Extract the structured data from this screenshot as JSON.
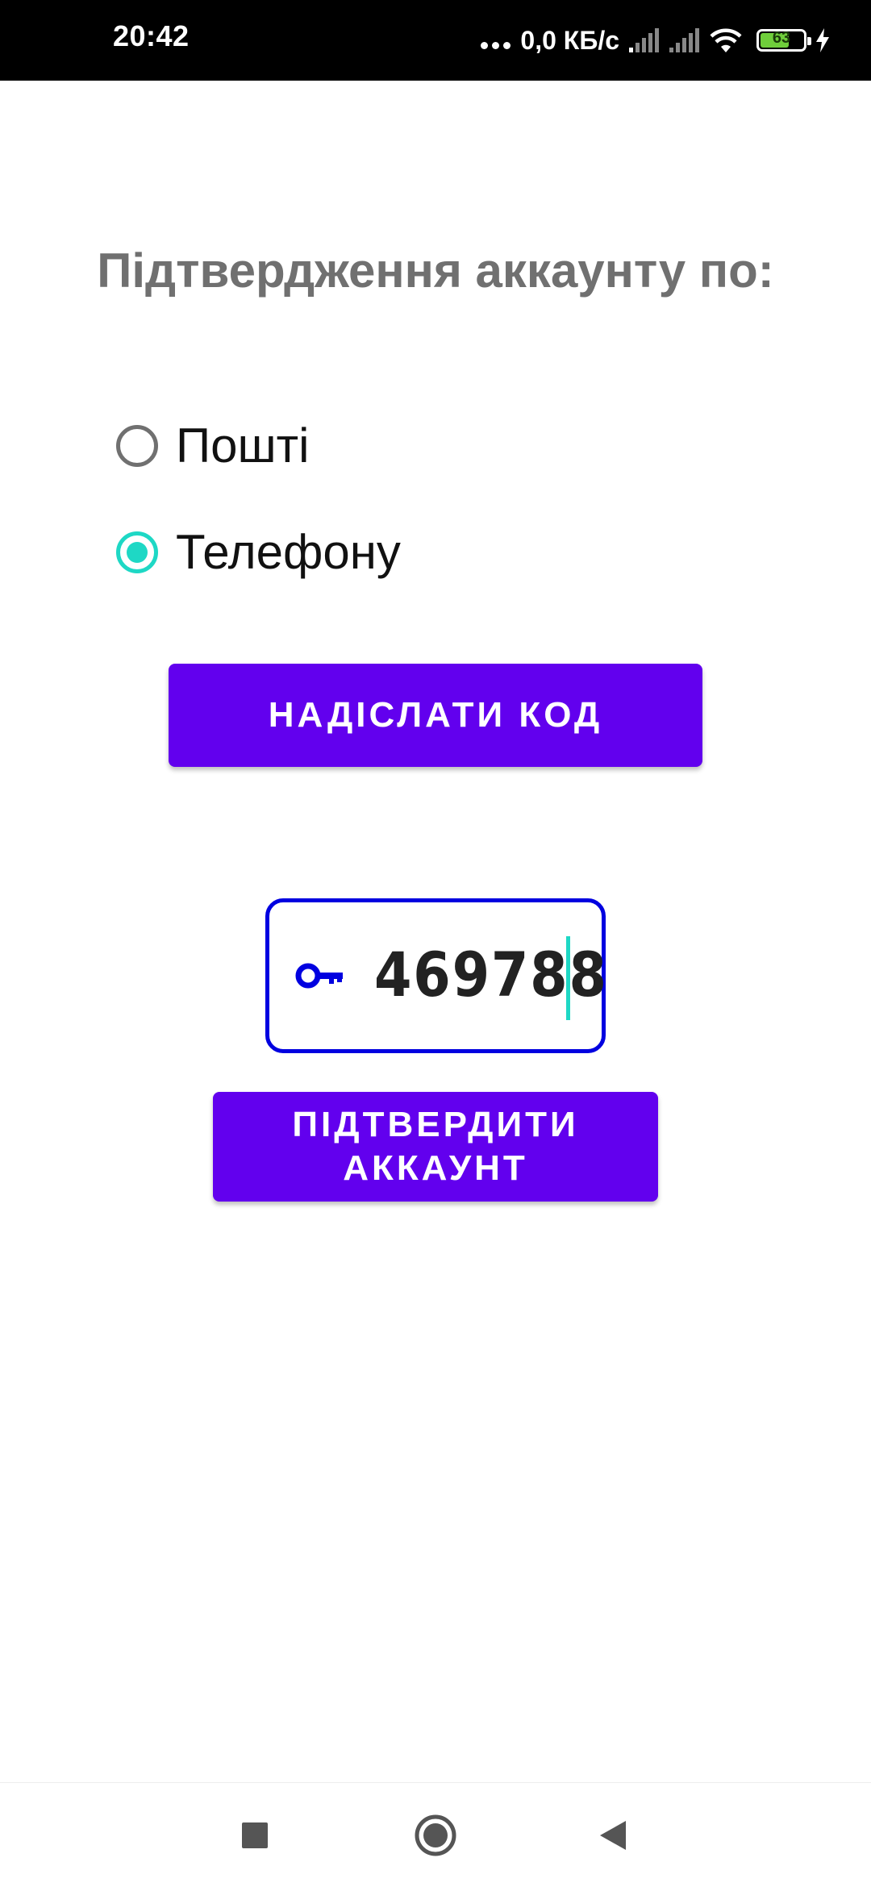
{
  "status_bar": {
    "time": "20:42",
    "network_speed": "0,0 КБ/с",
    "battery_level": "63",
    "icons": [
      "more-dots-icon",
      "signal-icon",
      "signal-icon",
      "wifi-icon",
      "battery-icon",
      "charging-icon"
    ]
  },
  "title": "Підтвердження аккаунту по:",
  "verification_options": [
    {
      "label": "Пошті",
      "checked": false
    },
    {
      "label": "Телефону",
      "checked": true
    }
  ],
  "send_code_button": "НАДІСЛАТИ КОД",
  "code_input": {
    "value": "469788",
    "icon": "key-icon"
  },
  "confirm_button": "ПІДТВЕРДИТИ\nАККАУНТ",
  "nav_bar": {
    "icons": [
      "recents-square-icon",
      "home-circle-icon",
      "back-triangle-icon"
    ]
  },
  "colors": {
    "accent": "#6200ee",
    "radio_checked": "#1ed8c5",
    "input_border": "#0000e0",
    "title_text": "#707070"
  }
}
